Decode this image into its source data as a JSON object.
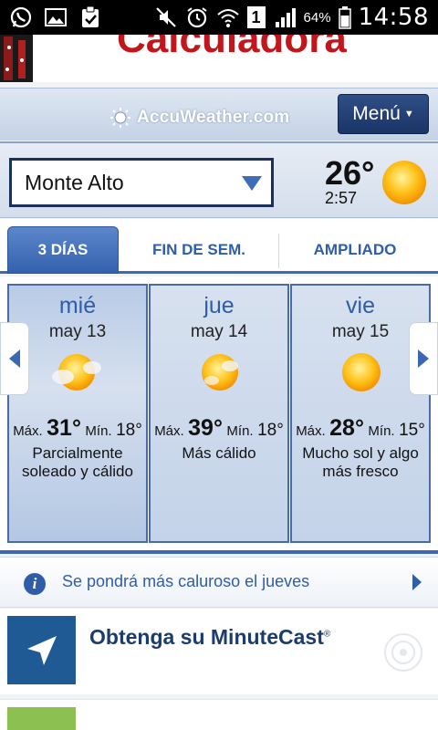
{
  "status_bar": {
    "notification_icons": [
      "whatsapp-icon",
      "gallery-icon",
      "clipboard-check-icon"
    ],
    "system_icons": [
      "mute-icon",
      "alarm-icon",
      "wifi-icon",
      "sim-1-icon",
      "signal-icon",
      "battery-icon"
    ],
    "sim_label": "1",
    "battery_percent": "64%",
    "time": "14:58"
  },
  "ad_banner": {
    "text": "Calculadora"
  },
  "header": {
    "logo": "AccuWeather.com",
    "menu_label": "Menú"
  },
  "location": {
    "name": "Monte Alto",
    "current_temp": "26°",
    "current_time": "2:57",
    "condition_icon": "sun-icon"
  },
  "tabs": [
    {
      "label": "3 DÍAS",
      "active": true
    },
    {
      "label": "FIN DE SEM.",
      "active": false
    },
    {
      "label": "AMPLIADO",
      "active": false
    }
  ],
  "forecast": [
    {
      "day": "mié",
      "date": "may 13",
      "icon": "partly-sunny-icon",
      "max_label": "Máx.",
      "max": "31°",
      "min_label": "Mín.",
      "min": "18°",
      "description": "Parcialmente soleado y cálido"
    },
    {
      "day": "jue",
      "date": "may 14",
      "icon": "partly-sunny-icon",
      "max_label": "Máx.",
      "max": "39°",
      "min_label": "Mín.",
      "min": "18°",
      "description": "Más cálido"
    },
    {
      "day": "vie",
      "date": "may 15",
      "icon": "sun-icon",
      "max_label": "Máx.",
      "max": "28°",
      "min_label": "Mín.",
      "min": "15°",
      "description": "Mucho sol y algo más fresco"
    }
  ],
  "alert": {
    "text": "Se pondrá más caluroso el jueves"
  },
  "promo": {
    "title": "Obtenga su MinuteCast",
    "reg_mark": "®"
  },
  "colors": {
    "accent_blue": "#2f5da8",
    "menu_navy": "#1a3466",
    "ad_red": "#c0161c",
    "sun_yellow": "#f7b500"
  }
}
